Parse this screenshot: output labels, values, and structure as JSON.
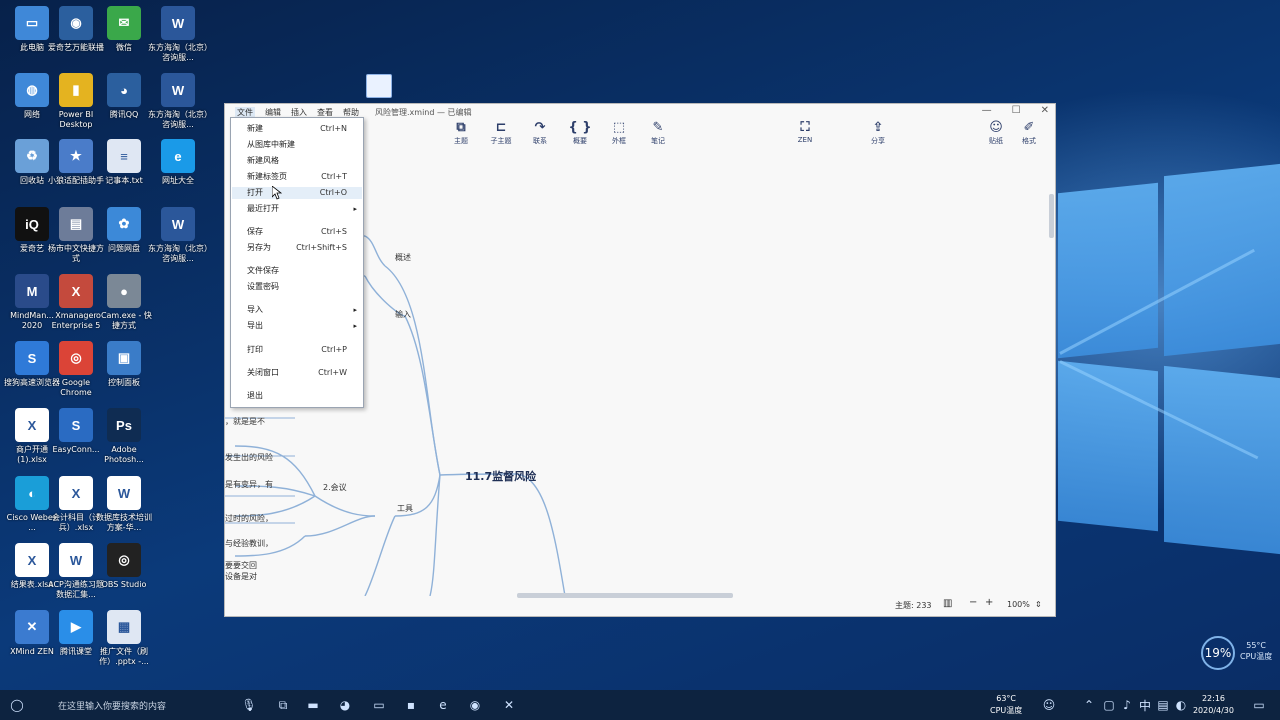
{
  "desktop": {
    "icons": [
      {
        "label": "此电脑",
        "glyph": "▭",
        "color": "#3f88d8"
      },
      {
        "label": "爱奇艺万能联播",
        "glyph": "◉",
        "color": "#2b5f9e"
      },
      {
        "label": "微信",
        "glyph": "✉",
        "color": "#3aa84a"
      },
      {
        "label": "东方海淘（北京）咨询服...",
        "glyph": "W",
        "color": "#2b579a"
      },
      {
        "label": "网络",
        "glyph": "◍",
        "color": "#3f88d8"
      },
      {
        "label": "Power BI Desktop",
        "glyph": "▮",
        "color": "#e4b320"
      },
      {
        "label": "腾讯QQ",
        "glyph": "◕",
        "color": "#2b5f9e"
      },
      {
        "label": "东方海淘（北京）咨询服...",
        "glyph": "W",
        "color": "#2b579a"
      },
      {
        "label": "回收站",
        "glyph": "♻",
        "color": "#6aa0d8"
      },
      {
        "label": "小狼适配插助手",
        "glyph": "★",
        "color": "#4a7cc9"
      },
      {
        "label": "记事本.txt",
        "glyph": "≡",
        "color": "#dfe7f3"
      },
      {
        "label": "网址大全",
        "glyph": "e",
        "color": "#1a9ae8"
      },
      {
        "label": "爱奇艺",
        "glyph": "iQ",
        "color": "#111111"
      },
      {
        "label": "杨市中文快捷方式",
        "glyph": "▤",
        "color": "#6d7c99"
      },
      {
        "label": "问题网盘",
        "glyph": "✿",
        "color": "#3c89d8"
      },
      {
        "label": "东方海淘（北京）咨询服...",
        "glyph": "W",
        "color": "#2b579a"
      },
      {
        "label": "MindMan... 2020",
        "glyph": "M",
        "color": "#2a4b8a"
      },
      {
        "label": "Xmanager Enterprise 5",
        "glyph": "X",
        "color": "#c44a3d"
      },
      {
        "label": "oCam.exe - 快捷方式",
        "glyph": "●",
        "color": "#7b8896"
      },
      {
        "label": "",
        "glyph": "",
        "color": "transparent"
      },
      {
        "label": "搜狗高速浏览器",
        "glyph": "S",
        "color": "#2f7ad8"
      },
      {
        "label": "Google Chrome",
        "glyph": "◎",
        "color": "#db4437"
      },
      {
        "label": "控制面板",
        "glyph": "▣",
        "color": "#3a7cc8"
      },
      {
        "label": "",
        "glyph": "",
        "color": "transparent"
      },
      {
        "label": "商户开通(1).xlsx",
        "glyph": "X",
        "color": "#ffffff"
      },
      {
        "label": "EasyConn...",
        "glyph": "S",
        "color": "#2a6bc2"
      },
      {
        "label": "Adobe Photosh...",
        "glyph": "Ps",
        "color": "#0f2c52"
      },
      {
        "label": "",
        "glyph": "",
        "color": "transparent"
      },
      {
        "label": "Cisco Webex ...",
        "glyph": "◐",
        "color": "#1a9ed8"
      },
      {
        "label": "会计科目（计兵）.xlsx",
        "glyph": "X",
        "color": "#ffffff"
      },
      {
        "label": "数据库技术培训方案-华...",
        "glyph": "W",
        "color": "#ffffff"
      },
      {
        "label": "",
        "glyph": "",
        "color": "transparent"
      },
      {
        "label": "结果表.xlsx",
        "glyph": "X",
        "color": "#ffffff"
      },
      {
        "label": "ACP沟通练习题数据汇集...",
        "glyph": "W",
        "color": "#ffffff"
      },
      {
        "label": "OBS Studio",
        "glyph": "◎",
        "color": "#222222"
      },
      {
        "label": "",
        "glyph": "",
        "color": "transparent"
      },
      {
        "label": "XMind ZEN",
        "glyph": "✕",
        "color": "#3b7bd0"
      },
      {
        "label": "腾讯课堂",
        "glyph": "▶",
        "color": "#2a8ee8"
      },
      {
        "label": "推广文件（刷作）.pptx -...",
        "glyph": "▦",
        "color": "#dfe7f3"
      }
    ]
  },
  "app": {
    "menu": [
      "文件",
      "编辑",
      "插入",
      "查看",
      "帮助"
    ],
    "doc_title": "风险管理.xmind — 已编辑",
    "window_controls": [
      "—",
      "☐",
      "✕"
    ],
    "toolbar": [
      {
        "icon": "⧉",
        "label": "主题"
      },
      {
        "icon": "⊏",
        "label": "子主题"
      },
      {
        "icon": "↷",
        "label": "联系"
      },
      {
        "icon": "{ }",
        "label": "概要"
      },
      {
        "icon": "⬚",
        "label": "外框"
      },
      {
        "icon": "✎",
        "label": "笔记"
      },
      {
        "icon": "⛶",
        "label": "ZEN"
      },
      {
        "icon": "⇪",
        "label": "分享"
      },
      {
        "icon": "☺",
        "label": "贴纸"
      },
      {
        "icon": "✐",
        "label": "格式"
      }
    ],
    "mindmap": {
      "central": "11.7监督风险",
      "branches": [
        "概述",
        "输入",
        "工具"
      ],
      "sub": "2.会议",
      "fragments": [
        "，就是是不",
        "发生出的风险",
        "是有变异，有",
        "过时的风险，",
        "与经验教训，",
        "要要交回",
        "设备是对"
      ]
    },
    "status": {
      "topics": "主题: 233",
      "zoom": "100%",
      "minus": "−",
      "plus": "+"
    }
  },
  "file_menu": {
    "items": [
      {
        "label": "新建",
        "key": "Ctrl+N"
      },
      {
        "label": "从图库中新建",
        "key": ""
      },
      {
        "label": "新建风格",
        "key": ""
      },
      {
        "label": "新建标签页",
        "key": "Ctrl+T"
      },
      {
        "label": "打开",
        "key": "Ctrl+O"
      },
      {
        "label": "最近打开",
        "key": "",
        "submenu": true
      },
      {
        "label": "保存",
        "key": "Ctrl+S"
      },
      {
        "label": "另存为",
        "key": "Ctrl+Shift+S"
      },
      {
        "label": "文件保存",
        "key": ""
      },
      {
        "label": "设置密码",
        "key": ""
      },
      {
        "label": "导入",
        "key": "",
        "submenu": true
      },
      {
        "label": "导出",
        "key": "",
        "submenu": true
      },
      {
        "label": "打印",
        "key": "Ctrl+P"
      },
      {
        "label": "关闭窗口",
        "key": "Ctrl+W"
      },
      {
        "label": "退出",
        "key": ""
      }
    ]
  },
  "taskbar": {
    "search_placeholder": "在这里输入你要搜索的内容",
    "cpu_temp": "63°C",
    "cpu_label": "CPU温度",
    "time": "22:16",
    "date": "2020/4/30"
  },
  "widget": {
    "percent": "19%",
    "temp": "55°C",
    "temp_label": "CPU温度"
  }
}
